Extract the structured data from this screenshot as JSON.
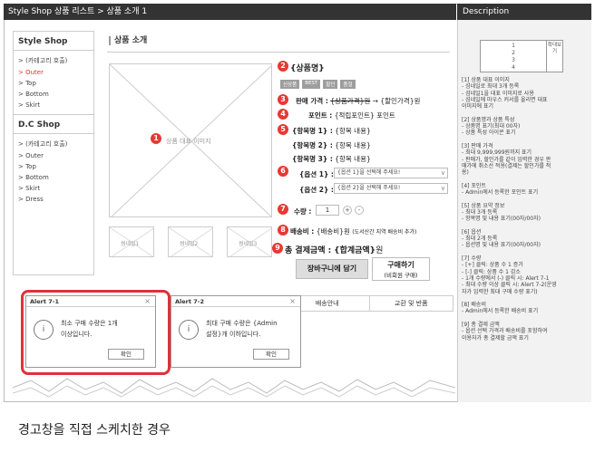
{
  "titlebar": "Style Shop 상품 리스트 > 상품 소개 1",
  "desc_title": "Description",
  "sidebar": {
    "group1_title": "Style Shop",
    "group1_items": [
      "> (카테고리 호출)",
      "> Outer",
      "> Top",
      "> Bottom",
      "> Skirt"
    ],
    "group2_title": "D.C Shop",
    "group2_items": [
      "> (카테고리 호출)",
      "> Outer",
      "> Top",
      "> Bottom",
      "> Skirt",
      "> Dress"
    ]
  },
  "page_title": "상품 소개",
  "main_image": "상품 대표 이미지",
  "thumbs": [
    "썸네일1",
    "썸네일2",
    "썸네일3"
  ],
  "product": {
    "name": "{상품명}",
    "badges": [
      "신상품",
      "BEST",
      "할인",
      "품절"
    ],
    "price_label": "판매 가격 :",
    "price_old": "{상품가격}원",
    "price_new": "→ {할인가격}원",
    "point_label": "포인트 :",
    "point_value": "{적립포인트} 포인트",
    "feature_label": "{항목명 1} :",
    "feature_value": "{항목 내용}",
    "feature2_label": "{항목명 2} :",
    "feature3_label": "{항목명 3} :",
    "option1_label": "{옵션 1} :",
    "option1_placeholder": "{옵션 1}을 선택해 주세요!",
    "option2_label": "{옵션 2} :",
    "option2_placeholder": "{옵션 2}을 선택해 주세요!",
    "qty_label": "수량 :",
    "qty_value": "1",
    "qty_plus": "+",
    "qty_minus": "-",
    "shipping_label": "배송비 :",
    "shipping_value": "{배송비}원",
    "shipping_note": "(도서산간 지역 배송비 추가)",
    "total_label": "총 결제금액 :",
    "total_value": "{합계금액}",
    "total_unit": "원",
    "cart_button": "장바구니에 담기",
    "buy_button": "구매하기",
    "buy_sub": "(비회원 구매)"
  },
  "tabs": [
    "배송안내",
    "교환 및 반품"
  ],
  "alert1": {
    "title": "Alert 7-1",
    "close": "×",
    "message_line1": "최소 구매 수량은 1개",
    "message_line2": "이상입니다.",
    "ok": "확인"
  },
  "alert2": {
    "title": "Alert 7-2",
    "close": "×",
    "message_line1": "최대 구매 수량은 {Admin",
    "message_line2": "설정}개 이하입니다.",
    "ok": "확인"
  },
  "markers": [
    "1",
    "2",
    "3",
    "4",
    "5",
    "6",
    "7",
    "8",
    "9"
  ],
  "desc_preview": {
    "lines": [
      "1",
      "2",
      "3",
      "4"
    ],
    "side": "확대보기"
  },
  "desc_text": "[1] 상품 대표 이미지\n- 섬네일로 최대 3개 등록\n- 섬네일1을 대표 이미지로 사용\n- 섬네일에 마우스 커서를 올리면 대표\n이미지에 표기\n\n[2] 상품명과 상품 특성\n- 상품명 표기(최대 00자)\n- 상품 특성 아이콘 표기\n\n[3] 판매 가격\n- 최대 9,999,999원까지 표기\n- 판매가, 할인가를 같이 입력한 경우 판\n매가에 취소선 적용(결제는 할인가를 적\n용)\n\n[4] 포인트\n- Admin에서 등록한 포인트 표기\n\n[5] 상품 요약 정보\n- 최대 3개 등록\n- 항목명 및 내용 표기(00자/00자)\n\n[6] 옵션\n- 최대 2개 등록\n- 옵션명 및 내용 표기(00자/00자)\n\n[7] 수량\n- [+] 클릭: 상품 수 1 증가\n- [-] 클릭: 상품 수 1 감소\n- 1개 수량에서 (-) 클릭 시: Alert 7-1\n- 최대 수량 이상 클릭 시: Alert 7-2(운영\n자가 입력한 최대 구매 수량 표기)\n\n[8] 배송비\n- Admin에서 등록한 배송비 표기\n\n[9] 총 결제 금액\n- 옵션 선택 가격과 배송비를 포함하여\n이용자가 총 결제할 금액 표기",
  "caption": "경고창을 직접 스케치한 경우",
  "colors": {
    "marker": "#e53935",
    "alert_highlight": "#e0303a",
    "titlebar": "#333333"
  }
}
